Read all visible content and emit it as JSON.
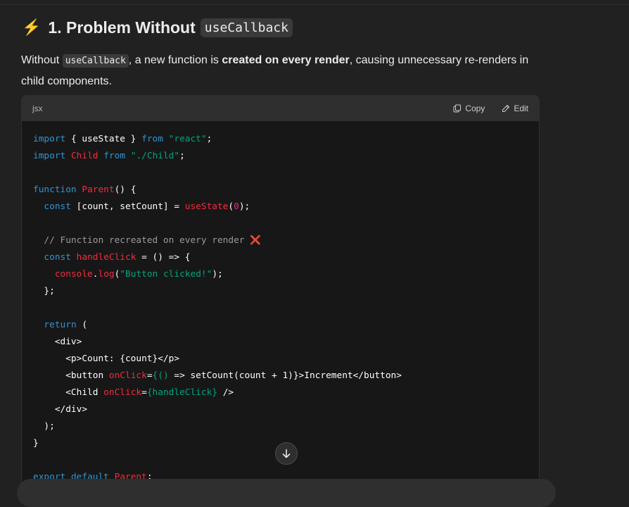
{
  "heading": {
    "emoji": "⚡",
    "text": "1. Problem Without",
    "code": "useCallback"
  },
  "paragraph": {
    "part1": "Without",
    "code": "useCallback",
    "part2": ", a new function is",
    "bold": "created on every render",
    "part3": ", causing unnecessary re-renders in child components."
  },
  "code_block": {
    "language": "jsx",
    "copy_label": "Copy",
    "edit_label": "Edit",
    "lines": [
      [
        [
          "kw",
          "import"
        ],
        [
          "pl",
          " { useState } "
        ],
        [
          "kw",
          "from"
        ],
        [
          "pl",
          " "
        ],
        [
          "str",
          "\"react\""
        ],
        [
          "pl",
          ";"
        ]
      ],
      [
        [
          "kw",
          "import"
        ],
        [
          "pl",
          " "
        ],
        [
          "fn",
          "Child"
        ],
        [
          "pl",
          " "
        ],
        [
          "kw",
          "from"
        ],
        [
          "pl",
          " "
        ],
        [
          "str",
          "\"./Child\""
        ],
        [
          "pl",
          ";"
        ]
      ],
      [],
      [
        [
          "kw",
          "function"
        ],
        [
          "pl",
          " "
        ],
        [
          "fn",
          "Parent"
        ],
        [
          "pl",
          "() {"
        ]
      ],
      [
        [
          "pl",
          "  "
        ],
        [
          "kw",
          "const"
        ],
        [
          "pl",
          " [count, setCount] = "
        ],
        [
          "fn",
          "useState"
        ],
        [
          "pl",
          "("
        ],
        [
          "num",
          "0"
        ],
        [
          "pl",
          ");"
        ]
      ],
      [],
      [
        [
          "pl",
          "  "
        ],
        [
          "com",
          "// Function recreated on every render "
        ],
        [
          "x",
          "❌"
        ]
      ],
      [
        [
          "pl",
          "  "
        ],
        [
          "kw",
          "const"
        ],
        [
          "pl",
          " "
        ],
        [
          "fn",
          "handleClick"
        ],
        [
          "pl",
          " = () => {"
        ]
      ],
      [
        [
          "pl",
          "    "
        ],
        [
          "fn",
          "console"
        ],
        [
          "pl",
          "."
        ],
        [
          "fn",
          "log"
        ],
        [
          "pl",
          "("
        ],
        [
          "str",
          "\"Button clicked!\""
        ],
        [
          "pl",
          ");"
        ]
      ],
      [
        [
          "pl",
          "  };"
        ]
      ],
      [],
      [
        [
          "pl",
          "  "
        ],
        [
          "kw",
          "return"
        ],
        [
          "pl",
          " ("
        ]
      ],
      [
        [
          "pl",
          "    <div>"
        ]
      ],
      [
        [
          "pl",
          "      <p>Count: {count}</p>"
        ]
      ],
      [
        [
          "pl",
          "      <button "
        ],
        [
          "fn",
          "onClick"
        ],
        [
          "pl",
          "="
        ],
        [
          "str",
          "{() "
        ],
        [
          "pl",
          "=> setCount(count + 1)}>Increment</button>"
        ]
      ],
      [
        [
          "pl",
          "      <Child "
        ],
        [
          "fn",
          "onClick"
        ],
        [
          "pl",
          "="
        ],
        [
          "str",
          "{handleClick}"
        ],
        [
          "pl",
          " />"
        ]
      ],
      [
        [
          "pl",
          "    </div>"
        ]
      ],
      [
        [
          "pl",
          "  );"
        ]
      ],
      [
        [
          "pl",
          "}"
        ]
      ],
      [],
      [
        [
          "kw",
          "export"
        ],
        [
          "pl",
          " "
        ],
        [
          "kw",
          "default"
        ],
        [
          "pl",
          " "
        ],
        [
          "fn",
          "Parent"
        ],
        [
          "pl",
          ";"
        ]
      ]
    ]
  },
  "colors": {
    "background": "#212121",
    "keyword": "#2e95d3",
    "string": "#00a67d",
    "function": "#f22c3d",
    "number": "#df3079",
    "comment": "#9a9a9a"
  },
  "icons": {
    "copy": "copy-icon",
    "edit": "pencil-icon",
    "scroll": "arrow-down-icon"
  }
}
